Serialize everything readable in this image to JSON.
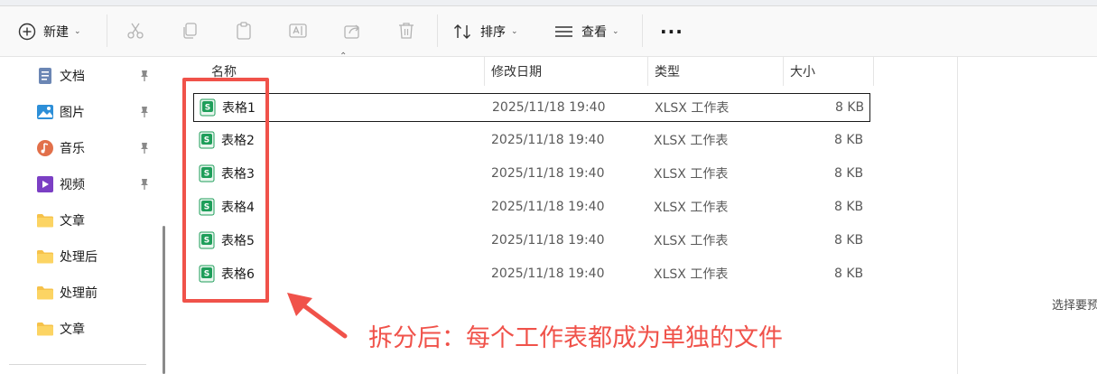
{
  "toolbar": {
    "new_label": "新建",
    "sort_label": "排序",
    "view_label": "查看",
    "more_label": "···"
  },
  "sidebar": {
    "items": [
      {
        "label": "文档",
        "icon": "document-icon",
        "pinned": true
      },
      {
        "label": "图片",
        "icon": "picture-icon",
        "pinned": true
      },
      {
        "label": "音乐",
        "icon": "music-icon",
        "pinned": true
      },
      {
        "label": "视频",
        "icon": "video-icon",
        "pinned": true
      },
      {
        "label": "文章",
        "icon": "folder-icon",
        "pinned": false
      },
      {
        "label": "处理后",
        "icon": "folder-icon",
        "pinned": false
      },
      {
        "label": "处理前",
        "icon": "folder-icon",
        "pinned": false
      },
      {
        "label": "文章",
        "icon": "folder-icon",
        "pinned": false
      }
    ]
  },
  "file_list": {
    "columns": [
      "名称",
      "修改日期",
      "类型",
      "大小"
    ],
    "rows": [
      {
        "name": "表格1",
        "modified": "2025/11/18 19:40",
        "type": "XLSX 工作表",
        "size": "8 KB",
        "selected": true
      },
      {
        "name": "表格2",
        "modified": "2025/11/18 19:40",
        "type": "XLSX 工作表",
        "size": "8 KB",
        "selected": false
      },
      {
        "name": "表格3",
        "modified": "2025/11/18 19:40",
        "type": "XLSX 工作表",
        "size": "8 KB",
        "selected": false
      },
      {
        "name": "表格4",
        "modified": "2025/11/18 19:40",
        "type": "XLSX 工作表",
        "size": "8 KB",
        "selected": false
      },
      {
        "name": "表格5",
        "modified": "2025/11/18 19:40",
        "type": "XLSX 工作表",
        "size": "8 KB",
        "selected": false
      },
      {
        "name": "表格6",
        "modified": "2025/11/18 19:40",
        "type": "XLSX 工作表",
        "size": "8 KB",
        "selected": false
      }
    ]
  },
  "details_pane": {
    "hint": "选择要预"
  },
  "annotation": {
    "text": "拆分后：每个工作表都成为单独的文件",
    "color": "#f0524a"
  },
  "colors": {
    "accent_green": "#1e9e5a",
    "folder_yellow": "#f6c24a"
  }
}
